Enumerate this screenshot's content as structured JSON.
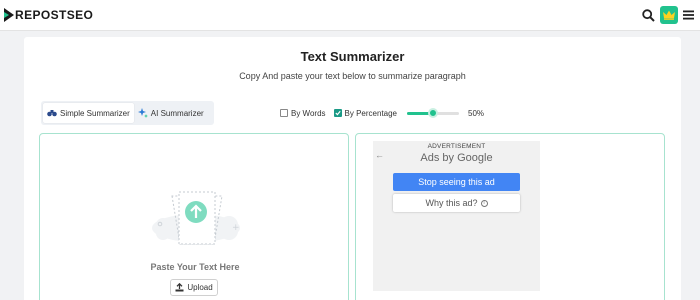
{
  "header": {
    "logo_text": "REPOSTSEO",
    "icons": [
      "search-icon",
      "crown-icon",
      "hamburger-menu-icon"
    ],
    "brand_color": "#21c28e"
  },
  "tool": {
    "title": "Text Summarizer",
    "subtitle": "Copy And paste your text below to summarize paragraph"
  },
  "modes": [
    {
      "label": "Simple Summarizer",
      "icon": "binoculars-icon",
      "active": true
    },
    {
      "label": "AI Summarizer",
      "icon": "sparkle-icon",
      "active": false
    }
  ],
  "options": {
    "by_words_label": "By Words",
    "by_words_checked": false,
    "by_percentage_label": "By Percentage",
    "by_percentage_checked": true,
    "slider_value": 0.5,
    "slider_label": "50%"
  },
  "input_panel": {
    "paste_label": "Paste Your Text Here",
    "upload_label": "Upload"
  },
  "ad": {
    "label": "ADVERTISEMENT",
    "ads_by_prefix": "Ads by",
    "ads_by_brand": "Google",
    "stop_label": "Stop seeing this ad",
    "why_label": "Why this ad?",
    "stop_color": "#4285f4"
  }
}
